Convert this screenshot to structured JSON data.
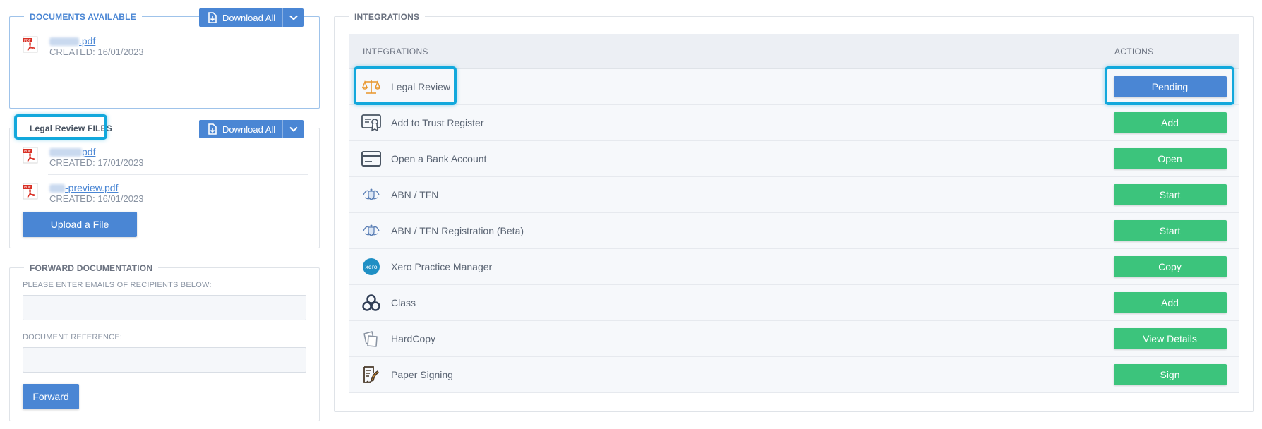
{
  "colors": {
    "primary": "#4a86d4",
    "success": "#3cc47c",
    "highlight": "#12a8dc",
    "pdf_red": "#d93025"
  },
  "documents_available": {
    "title": "DOCUMENTS AVAILABLE",
    "download_label": "Download All",
    "files": [
      {
        "name": ".pdf",
        "created": "CREATED: 16/01/2023"
      }
    ]
  },
  "legal_review_files": {
    "title": "Legal Review FILES",
    "download_label": "Download All",
    "files": [
      {
        "name": "pdf",
        "created": "CREATED: 17/01/2023"
      },
      {
        "name": "-preview.pdf",
        "created": "CREATED: 16/01/2023"
      }
    ],
    "upload_label": "Upload a File"
  },
  "forward_documentation": {
    "title": "FORWARD DOCUMENTATION",
    "emails_label": "PLEASE ENTER EMAILS OF RECIPIENTS BELOW:",
    "emails_value": "",
    "reference_label": "DOCUMENT REFERENCE:",
    "reference_value": "",
    "forward_label": "Forward"
  },
  "integrations": {
    "title": "INTEGRATIONS",
    "columns": [
      "INTEGRATIONS",
      "ACTIONS"
    ],
    "rows": [
      {
        "name": "Legal Review",
        "icon": "scales-icon",
        "action": "Pending",
        "status": "pending"
      },
      {
        "name": "Add to Trust Register",
        "icon": "certificate-icon",
        "action": "Add",
        "status": "available"
      },
      {
        "name": "Open a Bank Account",
        "icon": "credit-card-icon",
        "action": "Open",
        "status": "available"
      },
      {
        "name": "ABN / TFN",
        "icon": "coat-of-arms-icon",
        "action": "Start",
        "status": "available"
      },
      {
        "name": "ABN / TFN Registration (Beta)",
        "icon": "coat-of-arms-icon",
        "action": "Start",
        "status": "available"
      },
      {
        "name": "Xero Practice Manager",
        "icon": "xero-logo-icon",
        "action": "Copy",
        "status": "available"
      },
      {
        "name": "Class",
        "icon": "class-logo-icon",
        "action": "Add",
        "status": "available"
      },
      {
        "name": "HardCopy",
        "icon": "papers-icon",
        "action": "View Details",
        "status": "available"
      },
      {
        "name": "Paper Signing",
        "icon": "signing-pen-icon",
        "action": "Sign",
        "status": "available"
      }
    ]
  }
}
